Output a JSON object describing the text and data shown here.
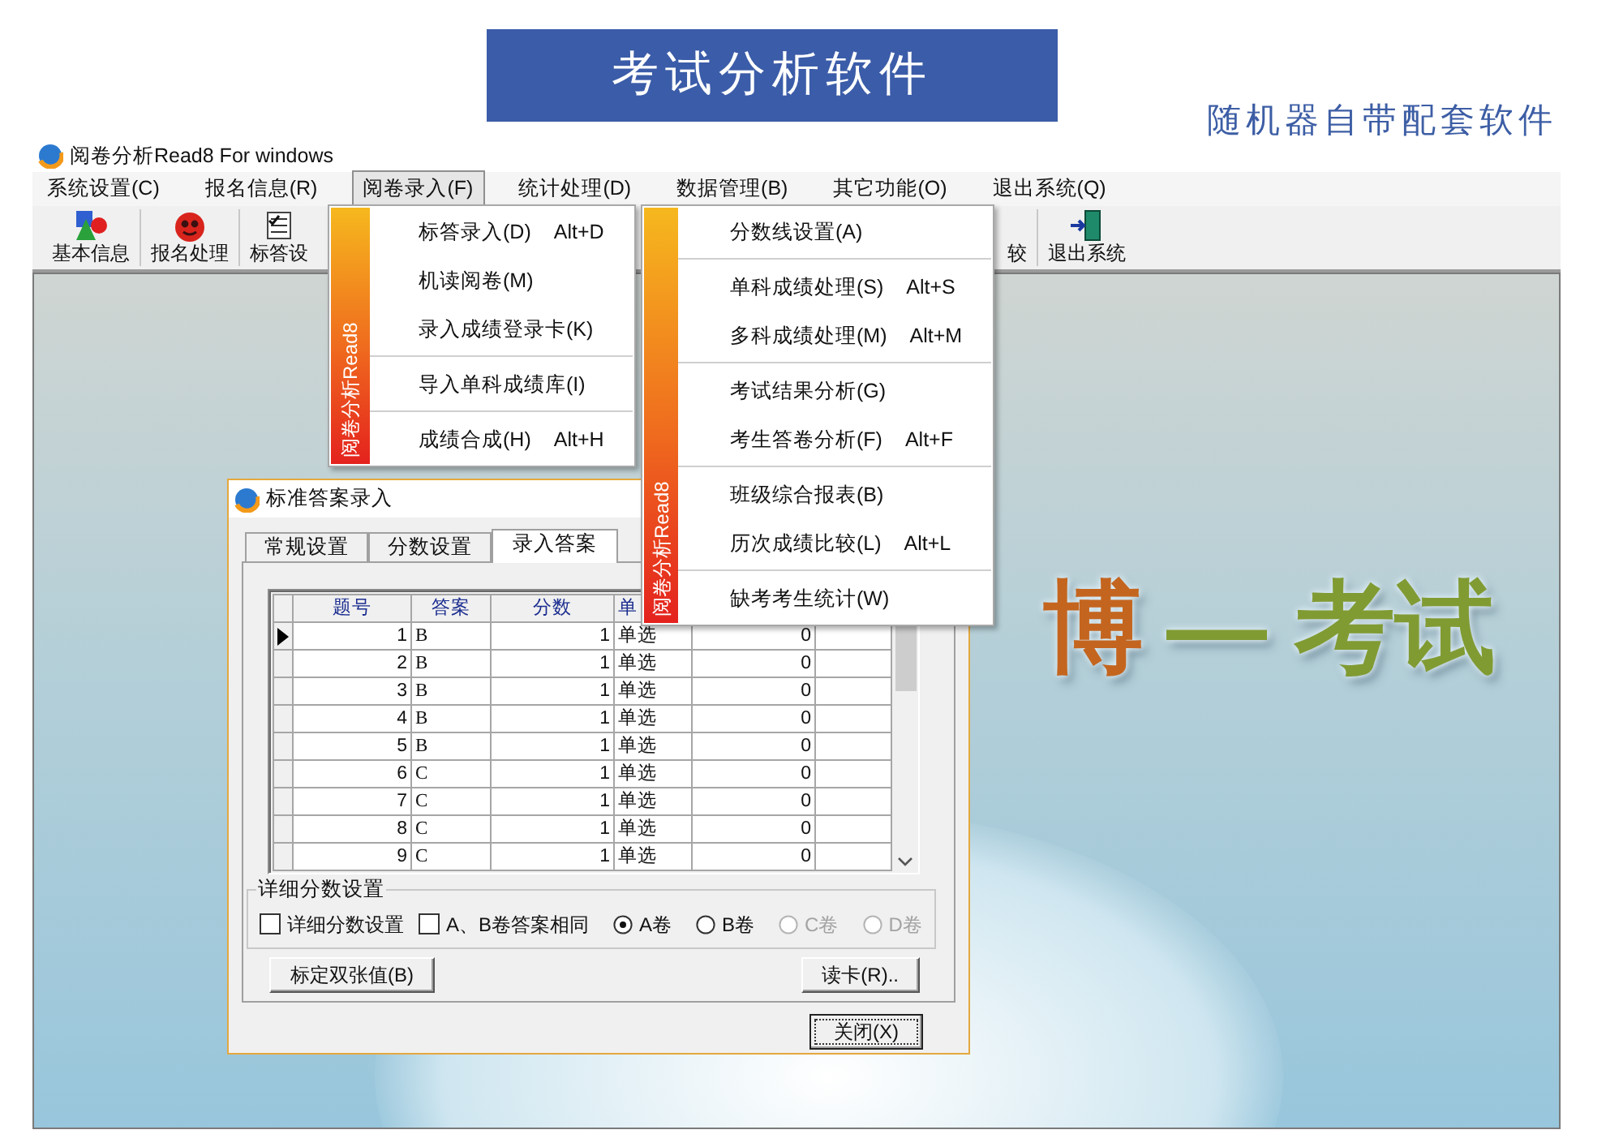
{
  "banner": {
    "title": "考试分析软件",
    "subtitle": "随机器自带配套软件"
  },
  "window": {
    "title": "阅卷分析Read8 For windows"
  },
  "menubar": [
    {
      "label": "系统设置(C)",
      "selected": false
    },
    {
      "label": "报名信息(R)",
      "selected": false
    },
    {
      "label": "阅卷录入(F)",
      "selected": true
    },
    {
      "label": "统计处理(D)",
      "selected": false
    },
    {
      "label": "数据管理(B)",
      "selected": false
    },
    {
      "label": "其它功能(O)",
      "selected": false
    },
    {
      "label": "退出系统(Q)",
      "selected": false
    }
  ],
  "toolbar": {
    "left": [
      {
        "kind": "shapes",
        "label": "基本信息"
      },
      {
        "kind": "ball",
        "label": "报名处理"
      },
      {
        "kind": "list",
        "label": "标答设"
      }
    ],
    "right": [
      {
        "kind": "plain",
        "label": "较"
      },
      {
        "kind": "door",
        "label": "退出系统"
      }
    ]
  },
  "menus": [
    {
      "side_label": "阅卷分析Read8",
      "items": [
        {
          "kind": "item",
          "label": "标答录入(D)",
          "shortcut": "Alt+D"
        },
        {
          "kind": "item",
          "label": "机读阅卷(M)"
        },
        {
          "kind": "item",
          "label": "录入成绩登录卡(K)"
        },
        {
          "kind": "separator"
        },
        {
          "kind": "item",
          "label": "导入单科成绩库(I)"
        },
        {
          "kind": "separator"
        },
        {
          "kind": "item",
          "label": "成绩合成(H)",
          "shortcut": "Alt+H"
        }
      ]
    },
    {
      "side_label": "阅卷分析Read8",
      "items": [
        {
          "kind": "item",
          "label": "分数线设置(A)"
        },
        {
          "kind": "separator"
        },
        {
          "kind": "item",
          "label": "单科成绩处理(S)",
          "shortcut": "Alt+S"
        },
        {
          "kind": "item",
          "label": "多科成绩处理(M)",
          "shortcut": "Alt+M"
        },
        {
          "kind": "separator"
        },
        {
          "kind": "item",
          "label": "考试结果分析(G)"
        },
        {
          "kind": "item",
          "label": "考生答卷分析(F)",
          "shortcut": "Alt+F"
        },
        {
          "kind": "separator"
        },
        {
          "kind": "item",
          "label": "班级综合报表(B)"
        },
        {
          "kind": "item",
          "label": "历次成绩比较(L)",
          "shortcut": "Alt+L"
        },
        {
          "kind": "separator"
        },
        {
          "kind": "item",
          "label": "缺考考生统计(W)"
        }
      ]
    }
  ],
  "splash": [
    {
      "text": "博",
      "color": "#c4651f"
    },
    {
      "text": "— 考试",
      "color": "#819b33"
    }
  ],
  "dialog": {
    "title": "标准答案录入",
    "tabs": [
      {
        "label": "常规设置",
        "selected": false
      },
      {
        "label": "分数设置",
        "selected": false
      },
      {
        "label": "录入答案",
        "selected": true
      }
    ],
    "grid": {
      "columns": [
        "题号",
        "答案",
        "分数",
        "单"
      ],
      "rows": [
        {
          "current": true,
          "cells": [
            "1",
            "B",
            "1",
            "单选",
            "0"
          ]
        },
        {
          "current": false,
          "cells": [
            "2",
            "B",
            "1",
            "单选",
            "0"
          ]
        },
        {
          "current": false,
          "cells": [
            "3",
            "B",
            "1",
            "单选",
            "0"
          ]
        },
        {
          "current": false,
          "cells": [
            "4",
            "B",
            "1",
            "单选",
            "0"
          ]
        },
        {
          "current": false,
          "cells": [
            "5",
            "B",
            "1",
            "单选",
            "0"
          ]
        },
        {
          "current": false,
          "cells": [
            "6",
            "C",
            "1",
            "单选",
            "0"
          ]
        },
        {
          "current": false,
          "cells": [
            "7",
            "C",
            "1",
            "单选",
            "0"
          ]
        },
        {
          "current": false,
          "cells": [
            "8",
            "C",
            "1",
            "单选",
            "0"
          ]
        },
        {
          "current": false,
          "cells": [
            "9",
            "C",
            "1",
            "单选",
            "0"
          ]
        }
      ]
    },
    "group": {
      "title": "详细分数设置",
      "controls": [
        {
          "kind": "checkbox",
          "label": "详细分数设置",
          "checked": false,
          "disabled": false
        },
        {
          "kind": "checkbox",
          "label": "A、B卷答案相同",
          "checked": false,
          "disabled": false
        },
        {
          "kind": "radio",
          "label": "A卷",
          "selected": true,
          "disabled": false
        },
        {
          "kind": "radio",
          "label": "B卷",
          "selected": false,
          "disabled": false
        },
        {
          "kind": "radio",
          "label": "C卷",
          "selected": false,
          "disabled": true
        },
        {
          "kind": "radio",
          "label": "D卷",
          "selected": false,
          "disabled": true
        }
      ]
    },
    "buttons": [
      {
        "label": "标定双张值(B)"
      },
      {
        "label": "读卡(R).."
      }
    ],
    "close_button": {
      "label": "关闭(X)",
      "focused": true
    }
  }
}
